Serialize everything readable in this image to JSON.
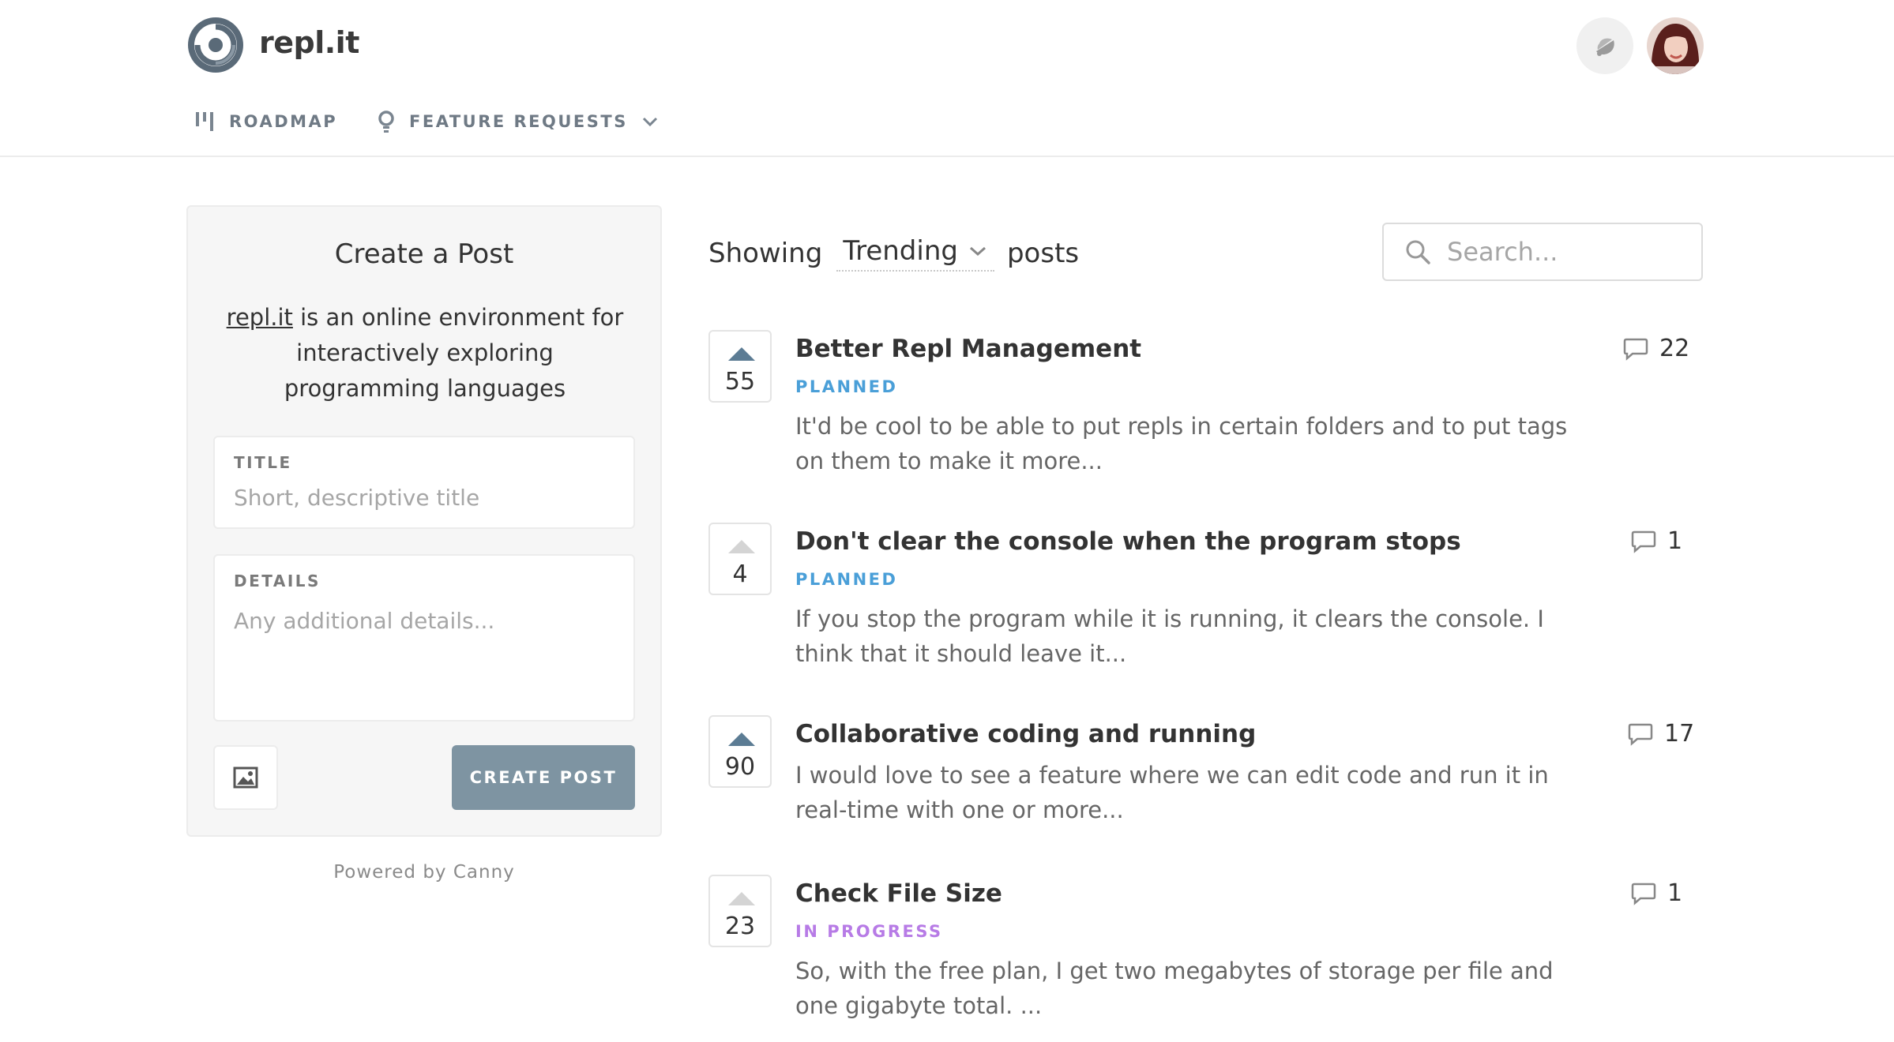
{
  "app": {
    "brand": "repl.it"
  },
  "nav": {
    "roadmap": "ROADMAP",
    "feature_requests": "FEATURE REQUESTS"
  },
  "create_post": {
    "title": "Create a Post",
    "desc_link": "repl.it",
    "desc_rest": " is an online environment for interactively exploring programming languages",
    "title_label": "TITLE",
    "title_placeholder": "Short, descriptive title",
    "details_label": "DETAILS",
    "details_placeholder": "Any additional details...",
    "submit_label": "CREATE POST",
    "powered_by": "Powered by Canny"
  },
  "list": {
    "showing": "Showing",
    "sort": "Trending",
    "posts_word": "posts",
    "search_placeholder": "Search..."
  },
  "colors": {
    "planned": "#4a9fd8",
    "in_progress": "#b77be6",
    "button": "#7e94a2"
  },
  "posts": [
    {
      "votes": "55",
      "voted": true,
      "title": "Better Repl Management",
      "status": "PLANNED",
      "body": "It'd be cool to be able to put repls in certain folders and to put tags on them to make it more...",
      "comments": "22"
    },
    {
      "votes": "4",
      "voted": false,
      "title": "Don't clear the console when the program stops",
      "status": "PLANNED",
      "body": "If you stop the program while it is running, it clears the console. I think that it should leave it...",
      "comments": "1"
    },
    {
      "votes": "90",
      "voted": true,
      "title": "Collaborative coding and running",
      "status": "",
      "body": "I would love to see a feature where we can edit code and run it in real-time with one or more...",
      "comments": "17"
    },
    {
      "votes": "23",
      "voted": false,
      "title": "Check File Size",
      "status": "IN PROGRESS",
      "body": "So, with the free plan, I get two megabytes of storage per file and one gigabyte total. ...",
      "comments": "1"
    }
  ]
}
